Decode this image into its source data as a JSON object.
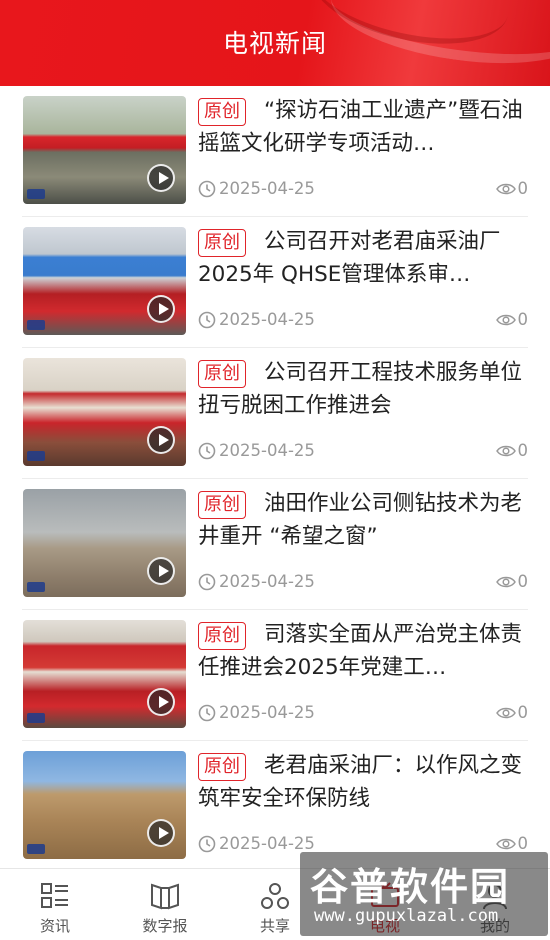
{
  "header": {
    "title": "电视新闻"
  },
  "tag_label": "原创",
  "articles": [
    {
      "title": "“探访石油工业遗产”暨石油摇篮文化研学专项活动…",
      "date": "2025-04-25",
      "views": "0",
      "scene": "outdoor-ceremony"
    },
    {
      "title": "公司召开对老君庙采油厂2025年 QHSE管理体系审…",
      "date": "2025-04-25",
      "views": "0",
      "scene": "meeting-room"
    },
    {
      "title": "公司召开工程技术服务单位扭亏脱困工作推进会",
      "date": "2025-04-25",
      "views": "0",
      "scene": "conference"
    },
    {
      "title": "油田作业公司侧钻技术为老井重开 “希望之窗”",
      "date": "2025-04-25",
      "views": "0",
      "scene": "drilling-rig"
    },
    {
      "title": "司落实全面从严治党主体责任推进会2025年党建工…",
      "date": "2025-04-25",
      "views": "0",
      "scene": "party-meeting"
    },
    {
      "title": "老君庙采油厂：以作风之变筑牢安全环保防线",
      "date": "2025-04-25",
      "views": "0",
      "scene": "field-site"
    }
  ],
  "tabbar": {
    "items": [
      {
        "label": "资讯",
        "icon": "news-list-icon"
      },
      {
        "label": "数字报",
        "icon": "newspaper-icon"
      },
      {
        "label": "共享",
        "icon": "share-nodes-icon"
      },
      {
        "label": "电视",
        "icon": "tv-icon"
      },
      {
        "label": "我的",
        "icon": "user-icon"
      }
    ]
  },
  "watermark": {
    "text": "谷普软件园",
    "url": "www.gupuxlazal.com"
  },
  "colors": {
    "brand_red": "#e0242a",
    "muted": "#999999"
  }
}
